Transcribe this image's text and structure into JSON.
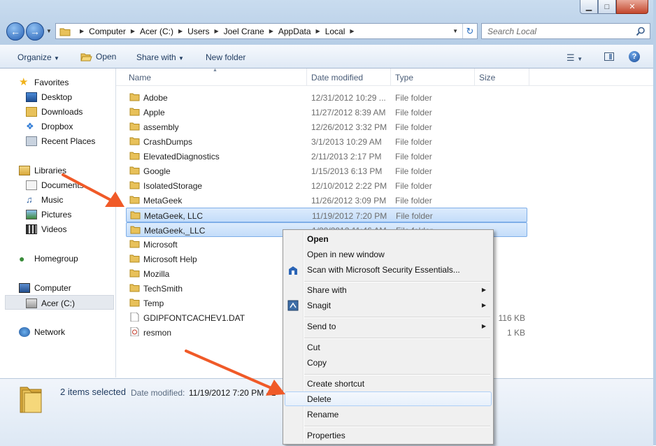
{
  "window": {
    "controls": {
      "minimize": "▁",
      "maximize": "□",
      "close": "✕"
    }
  },
  "address": {
    "crumbs": [
      "Computer",
      "Acer (C:)",
      "Users",
      "Joel Crane",
      "AppData",
      "Local"
    ]
  },
  "search": {
    "placeholder": "Search Local"
  },
  "toolbar": {
    "organize": "Organize",
    "open": "Open",
    "share_with": "Share with",
    "new_folder": "New folder"
  },
  "nav": {
    "favorites": "Favorites",
    "desktop": "Desktop",
    "downloads": "Downloads",
    "dropbox": "Dropbox",
    "recent": "Recent Places",
    "libraries": "Libraries",
    "documents": "Documents",
    "music": "Music",
    "pictures": "Pictures",
    "videos": "Videos",
    "homegroup": "Homegroup",
    "computer": "Computer",
    "acer": "Acer (C:)",
    "network": "Network"
  },
  "columns": {
    "name": "Name",
    "date": "Date modified",
    "type": "Type",
    "size": "Size"
  },
  "files": [
    {
      "name": "Adobe",
      "date": "12/31/2012 10:29 ...",
      "type": "File folder",
      "size": ""
    },
    {
      "name": "Apple",
      "date": "11/27/2012 8:39 AM",
      "type": "File folder",
      "size": ""
    },
    {
      "name": "assembly",
      "date": "12/26/2012 3:32 PM",
      "type": "File folder",
      "size": ""
    },
    {
      "name": "CrashDumps",
      "date": "3/1/2013 10:29 AM",
      "type": "File folder",
      "size": ""
    },
    {
      "name": "ElevatedDiagnostics",
      "date": "2/11/2013 2:17 PM",
      "type": "File folder",
      "size": ""
    },
    {
      "name": "Google",
      "date": "1/15/2013 6:13 PM",
      "type": "File folder",
      "size": ""
    },
    {
      "name": "IsolatedStorage",
      "date": "12/10/2012 2:22 PM",
      "type": "File folder",
      "size": ""
    },
    {
      "name": "MetaGeek",
      "date": "11/26/2012 3:09 PM",
      "type": "File folder",
      "size": ""
    },
    {
      "name": "MetaGeek, LLC",
      "date": "11/19/2012 7:20 PM",
      "type": "File folder",
      "size": ""
    },
    {
      "name": "MetaGeek,_LLC",
      "date": "1/20/2012 11:46 AM",
      "type": "File folder",
      "size": ""
    },
    {
      "name": "Microsoft",
      "date": "",
      "type": "",
      "size": ""
    },
    {
      "name": "Microsoft Help",
      "date": "",
      "type": "",
      "size": ""
    },
    {
      "name": "Mozilla",
      "date": "",
      "type": "",
      "size": ""
    },
    {
      "name": "TechSmith",
      "date": "",
      "type": "",
      "size": ""
    },
    {
      "name": "Temp",
      "date": "",
      "type": "",
      "size": ""
    },
    {
      "name": "GDIPFONTCACHEV1.DAT",
      "date": "",
      "type": "",
      "size": "116 KB"
    },
    {
      "name": "resmon",
      "date": "",
      "type": "",
      "size": "1 KB"
    }
  ],
  "status": {
    "selected": "2 items selected",
    "date_label": "Date modified:",
    "date_value": "11/19/2012 7:20 PM - 1"
  },
  "context_menu": {
    "open": "Open",
    "open_new_window": "Open in new window",
    "scan": "Scan with Microsoft Security Essentials...",
    "share_with": "Share with",
    "snagit": "Snagit",
    "send_to": "Send to",
    "cut": "Cut",
    "copy": "Copy",
    "create_shortcut": "Create shortcut",
    "delete": "Delete",
    "rename": "Rename",
    "properties": "Properties"
  },
  "colors": {
    "accent_arrow": "#f05a28",
    "selection": "#cde4fb",
    "chrome": "#bcd2ea"
  }
}
